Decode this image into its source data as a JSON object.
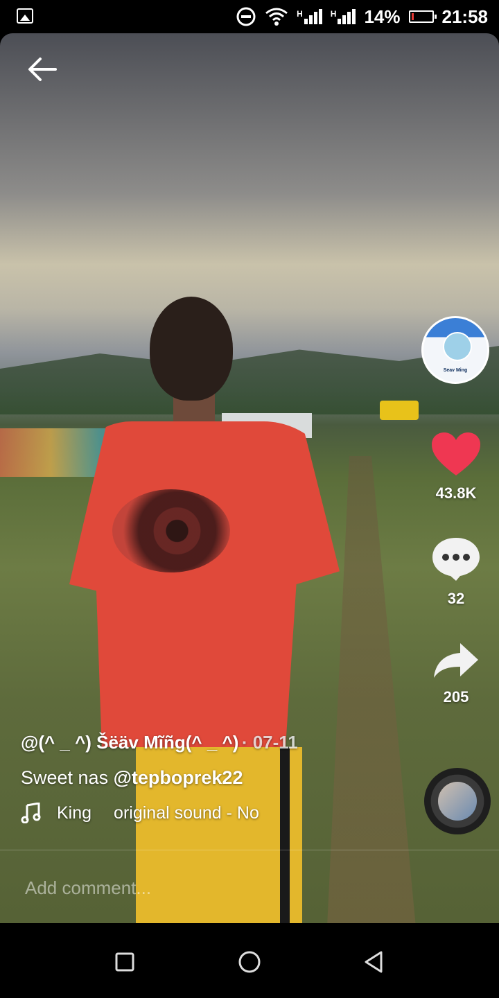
{
  "status_bar": {
    "signal_1_label": "H",
    "signal_2_label": "H",
    "battery_percent": "14%",
    "battery_level": 0.14,
    "time": "21:58"
  },
  "video": {
    "back_icon": "arrow-left-icon"
  },
  "profile": {
    "avatar_text": "Seav Ming"
  },
  "actions": {
    "like_count": "43.8K",
    "comment_count": "32",
    "share_count": "205"
  },
  "post": {
    "username": "@(^ _ ^) Šëäv Mĩñg(^ _ ^)",
    "date": "· 07-11",
    "caption_text": "Sweet nas ",
    "caption_mention": "@tepboprek22",
    "music_artist": "King",
    "music_title": "original sound - No"
  },
  "comment_box": {
    "placeholder": "Add comment..."
  },
  "colors": {
    "like_red": "#ef3752",
    "battery_red": "#e53935"
  },
  "nav": {
    "recent_icon": "square-icon",
    "home_icon": "circle-icon",
    "back_icon": "triangle-back-icon"
  }
}
